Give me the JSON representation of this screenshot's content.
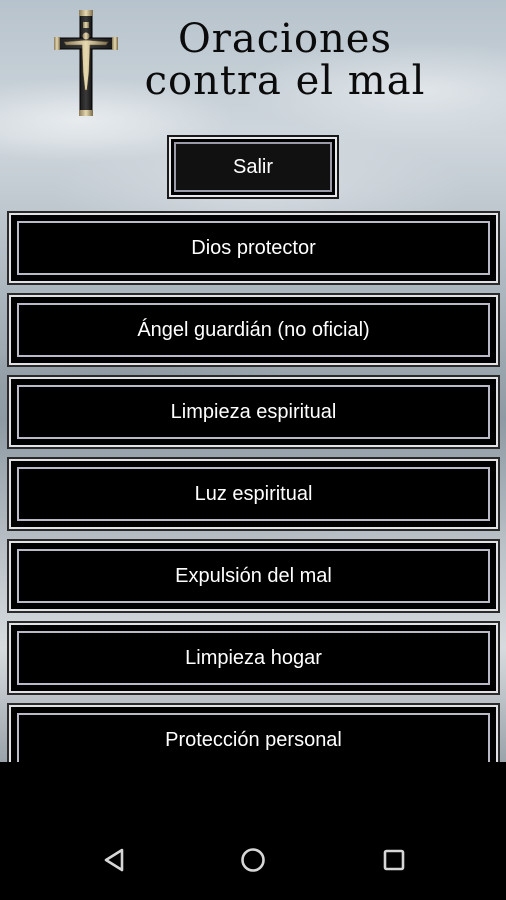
{
  "header": {
    "title_line1": "Oraciones",
    "title_line2": "contra el mal"
  },
  "exit_label": "Salir",
  "menu": {
    "items": [
      {
        "label": "Dios protector"
      },
      {
        "label": "Ángel guardián (no oficial)"
      },
      {
        "label": "Limpieza espiritual"
      },
      {
        "label": "Luz espiritual"
      },
      {
        "label": "Expulsión del mal"
      },
      {
        "label": "Limpieza hogar"
      },
      {
        "label": "Protección personal"
      }
    ]
  },
  "navbar": {
    "icons": [
      "back-triangle-icon",
      "home-circle-icon",
      "recents-square-icon"
    ]
  },
  "colors": {
    "button_bg": "#000000",
    "button_border": "#e2e2e6",
    "text": "#ffffff"
  }
}
